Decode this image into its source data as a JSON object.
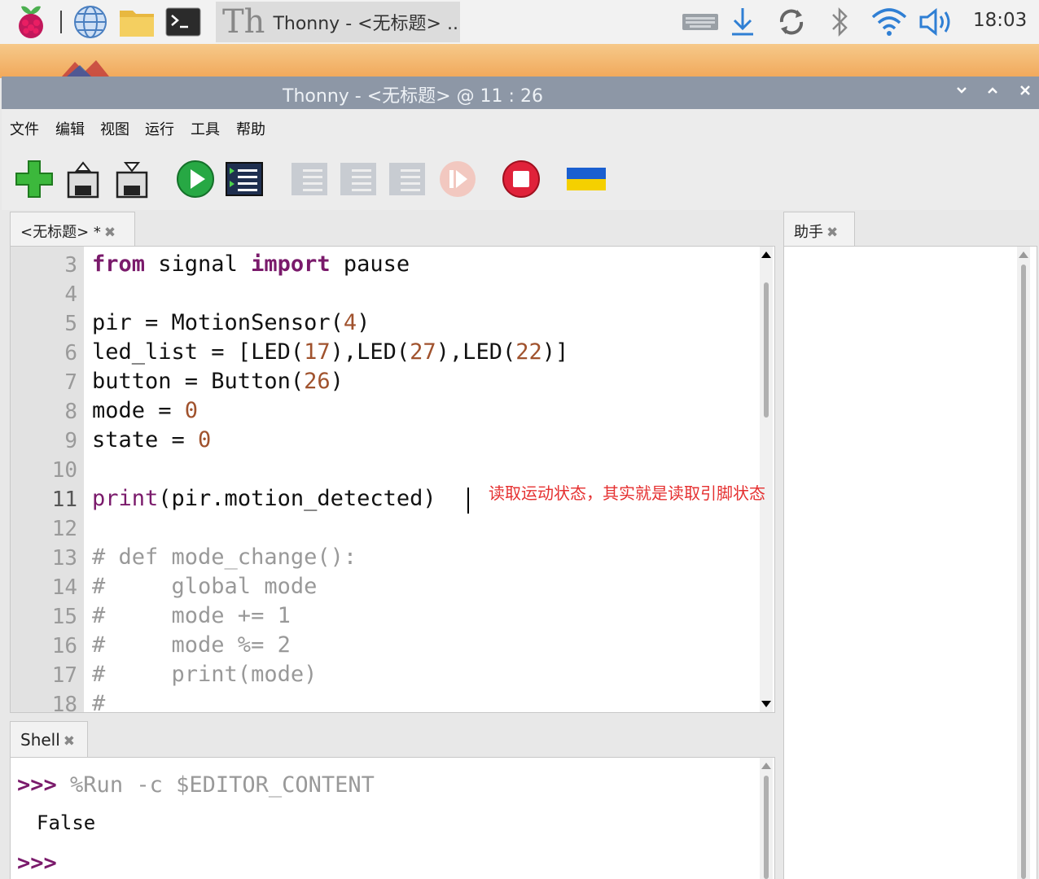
{
  "taskbar": {
    "task_title": "Thonny  -  <无标题> ..",
    "task_icon_letters": "Th",
    "clock": "18:03"
  },
  "window": {
    "title": "Thonny  -  <无标题>  @  11 : 26"
  },
  "menu": [
    "文件",
    "编辑",
    "视图",
    "运行",
    "工具",
    "帮助"
  ],
  "toolbar": {
    "icons": [
      "new-file-icon",
      "open-file-icon",
      "save-file-icon",
      "run-icon",
      "debug-icon",
      "step-over-icon",
      "step-into-icon",
      "step-out-icon",
      "resume-icon",
      "stop-icon",
      "ukraine-flag-icon"
    ]
  },
  "editor": {
    "tab_label": "<无标题> *",
    "lines": [
      {
        "n": "3",
        "tokens": [
          [
            "kw",
            "from"
          ],
          [
            "t",
            " signal "
          ],
          [
            "kw",
            "import"
          ],
          [
            "t",
            " pause"
          ]
        ]
      },
      {
        "n": "4",
        "tokens": []
      },
      {
        "n": "5",
        "tokens": [
          [
            "t",
            "pir = MotionSensor("
          ],
          [
            "num",
            "4"
          ],
          [
            "t",
            ")"
          ]
        ]
      },
      {
        "n": "6",
        "tokens": [
          [
            "t",
            "led_list = [LED("
          ],
          [
            "num",
            "17"
          ],
          [
            "t",
            "),LED("
          ],
          [
            "num",
            "27"
          ],
          [
            "t",
            "),LED("
          ],
          [
            "num",
            "22"
          ],
          [
            "t",
            ")]"
          ]
        ]
      },
      {
        "n": "7",
        "tokens": [
          [
            "t",
            "button = Button("
          ],
          [
            "num",
            "26"
          ],
          [
            "t",
            ")"
          ]
        ]
      },
      {
        "n": "8",
        "tokens": [
          [
            "t",
            "mode = "
          ],
          [
            "num",
            "0"
          ]
        ]
      },
      {
        "n": "9",
        "tokens": [
          [
            "t",
            "state = "
          ],
          [
            "num",
            "0"
          ]
        ]
      },
      {
        "n": "10",
        "tokens": []
      },
      {
        "n": "11",
        "tokens": [
          [
            "fn",
            "print"
          ],
          [
            "t",
            "(pir.motion_detected)"
          ]
        ]
      },
      {
        "n": "12",
        "tokens": []
      },
      {
        "n": "13",
        "tokens": [
          [
            "cm",
            "# def mode_change():"
          ]
        ]
      },
      {
        "n": "14",
        "tokens": [
          [
            "cm",
            "#     global mode"
          ]
        ]
      },
      {
        "n": "15",
        "tokens": [
          [
            "cm",
            "#     mode += 1"
          ]
        ]
      },
      {
        "n": "16",
        "tokens": [
          [
            "cm",
            "#     mode %= 2"
          ]
        ]
      },
      {
        "n": "17",
        "tokens": [
          [
            "cm",
            "#     print(mode)"
          ]
        ]
      },
      {
        "n": "18",
        "tokens": [
          [
            "cm",
            "#"
          ]
        ]
      }
    ],
    "annotation": "读取运动状态，其实就是读取引脚状态"
  },
  "shell": {
    "tab_label": "Shell",
    "prompt": ">>>",
    "command": "%Run -c $EDITOR_CONTENT",
    "output": "False"
  },
  "assistant": {
    "tab_label": "助手"
  }
}
